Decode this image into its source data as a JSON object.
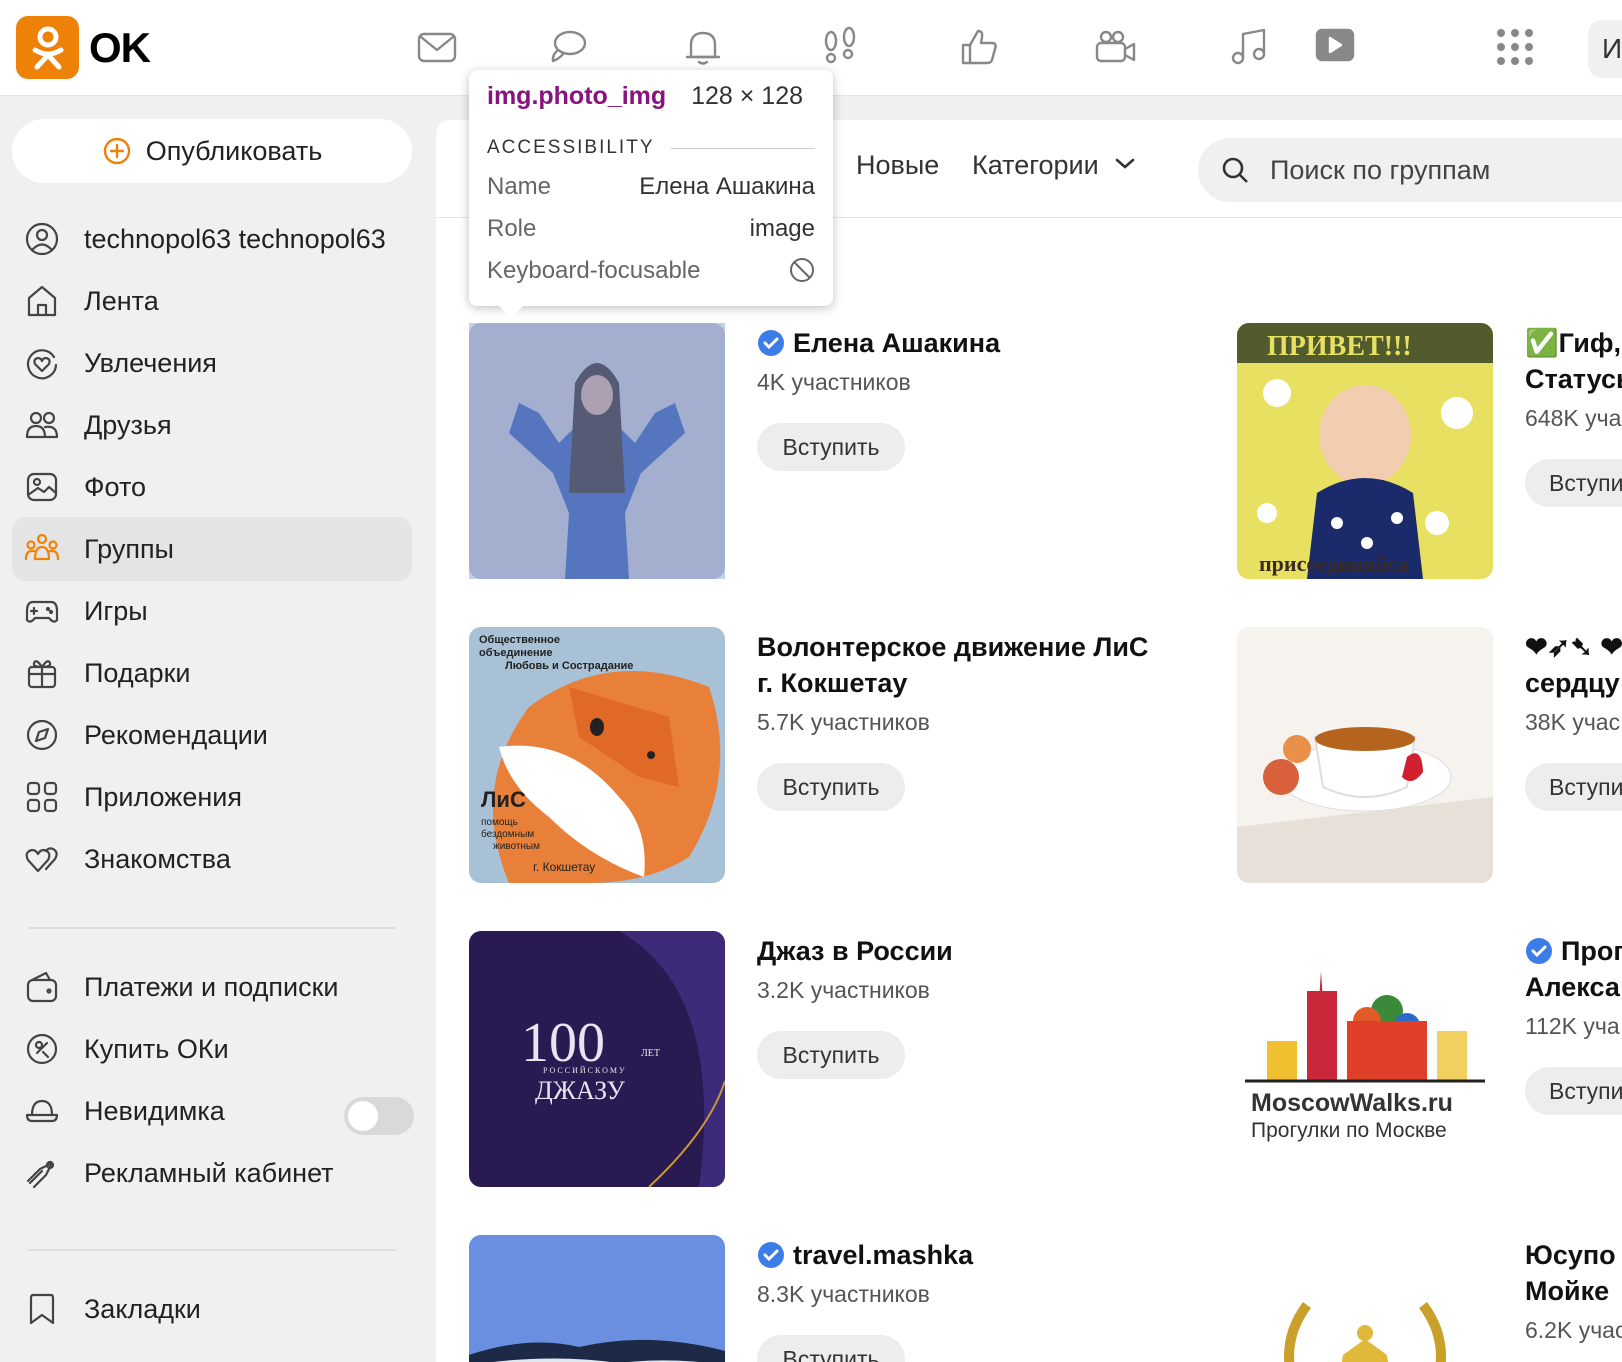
{
  "brand": {
    "name": "OK"
  },
  "topbar": {
    "icons": [
      "mail-icon",
      "chat-icon",
      "bell-icon",
      "footprints-icon",
      "thumbs-up-icon",
      "camera-icon",
      "music-icon",
      "video-icon",
      "apps-grid-icon"
    ],
    "user_initial": "И"
  },
  "sidebar": {
    "publish_label": "Опубликовать",
    "items": [
      {
        "label": "technopol63 technopol63",
        "icon": "profile-icon"
      },
      {
        "label": "Лента",
        "icon": "home-icon"
      },
      {
        "label": "Увлечения",
        "icon": "hobby-icon"
      },
      {
        "label": "Друзья",
        "icon": "friends-icon"
      },
      {
        "label": "Фото",
        "icon": "photo-icon"
      },
      {
        "label": "Группы",
        "icon": "groups-icon",
        "active": true
      },
      {
        "label": "Игры",
        "icon": "gamepad-icon"
      },
      {
        "label": "Подарки",
        "icon": "gift-icon"
      },
      {
        "label": "Рекомендации",
        "icon": "compass-icon"
      },
      {
        "label": "Приложения",
        "icon": "apps-icon"
      },
      {
        "label": "Знакомства",
        "icon": "hearts-icon"
      }
    ],
    "items2": [
      {
        "label": "Платежи и подписки",
        "icon": "wallet-icon"
      },
      {
        "label": "Купить ОКи",
        "icon": "coin-icon"
      },
      {
        "label": "Невидимка",
        "icon": "invisible-icon",
        "toggle": false
      },
      {
        "label": "Рекламный кабинет",
        "icon": "megaphone-icon"
      }
    ],
    "items3": [
      {
        "label": "Закладки",
        "icon": "bookmark-icon"
      }
    ]
  },
  "main": {
    "tabs": [
      "Новые",
      "Категории"
    ],
    "search_placeholder": "Поиск по группам",
    "groups_left": [
      {
        "title": "Елена Ашакина",
        "verified": true,
        "count": "4K участников",
        "join": "Вступить"
      },
      {
        "title_line1": "Волонтерское движение ЛиС",
        "title_line2": "г. Кокшетау",
        "count": "5.7K участников",
        "join": "Вступить",
        "thumb_text": [
          "Общественное",
          "объединение",
          "Любовь и Сострадание",
          "ЛиС",
          "помощь",
          "бездомным",
          "животным",
          "г. Кокшетау"
        ]
      },
      {
        "title": "Джаз в России",
        "count": "3.2K участников",
        "join": "Вступить",
        "thumb_text": [
          "100",
          "ЛЕТ",
          "РОССИЙСКОМУ",
          "ДЖАЗУ"
        ]
      },
      {
        "title": "travel.mashka",
        "verified": true,
        "count": "8.3K участников",
        "join": "Вступить"
      }
    ],
    "groups_right": [
      {
        "title_line1": "✅Гиф,(",
        "title_line2": "Статусы",
        "count": "648K уча",
        "join": "Вступи",
        "thumb_text": [
          "ПРИВЕТ!!!",
          "присоединяйся"
        ]
      },
      {
        "title_line1": "❤➶➷ ❤",
        "title_line2": "сердцу",
        "count": "38K учас",
        "join": "Вступи"
      },
      {
        "title_line1": "Прог",
        "title_line2": "Алекса",
        "verified": true,
        "count": "112K уча",
        "join": "Вступи",
        "thumb_text": [
          "MoscowWalks.ru",
          "Прогулки по Москве"
        ]
      },
      {
        "title_line1": "Юсупо",
        "title_line2": "Мойке",
        "count": "6.2K учас"
      }
    ]
  },
  "devtools_tooltip": {
    "selector": "img.photo_img",
    "dimensions": "128 × 128",
    "section": "ACCESSIBILITY",
    "rows": [
      {
        "key": "Name",
        "value": "Елена Ашакина"
      },
      {
        "key": "Role",
        "value": "image"
      },
      {
        "key": "Keyboard-focusable",
        "value": "not-focusable-icon"
      }
    ]
  },
  "colors": {
    "brand_orange": "#ee8208",
    "verified_blue": "#3d7be8",
    "background": "#f0f0f0"
  }
}
